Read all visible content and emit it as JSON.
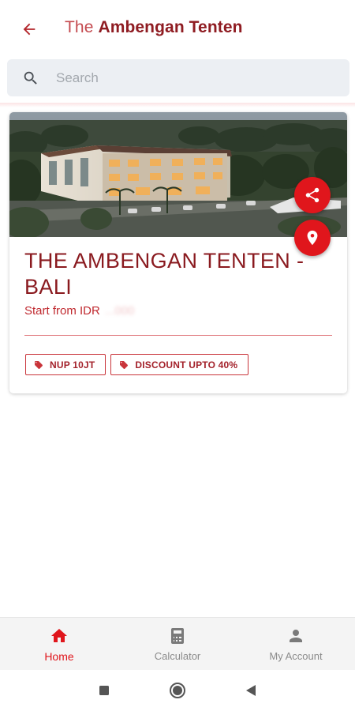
{
  "app_bar": {
    "title_prefix": "The",
    "title_main": "Ambengan Tenten",
    "back_icon": "arrow-left-icon"
  },
  "search": {
    "placeholder": "Search",
    "value": "",
    "icon": "search-icon"
  },
  "listing": {
    "title": "THE AMBENGAN TENTEN - BALI",
    "price_label": "Start from IDR",
    "price_value_hidden": "...000",
    "share_icon": "share-icon",
    "location_icon": "location-pin-icon",
    "tags": [
      {
        "label": "NUP 10JT",
        "icon": "tag-icon"
      },
      {
        "label": "DISCOUNT UPTO 40%",
        "icon": "tag-icon"
      }
    ]
  },
  "bottom_nav": {
    "items": [
      {
        "label": "Home",
        "icon": "home-icon",
        "active": true
      },
      {
        "label": "Calculator",
        "icon": "calculator-icon",
        "active": false
      },
      {
        "label": "My Account",
        "icon": "person-icon",
        "active": false
      }
    ]
  },
  "colors": {
    "brand_red": "#e0161c",
    "dark_red": "#8a1a1f",
    "search_bg": "#eceff3",
    "nav_bg": "#f4f4f4",
    "inactive": "#8b8b8b"
  }
}
